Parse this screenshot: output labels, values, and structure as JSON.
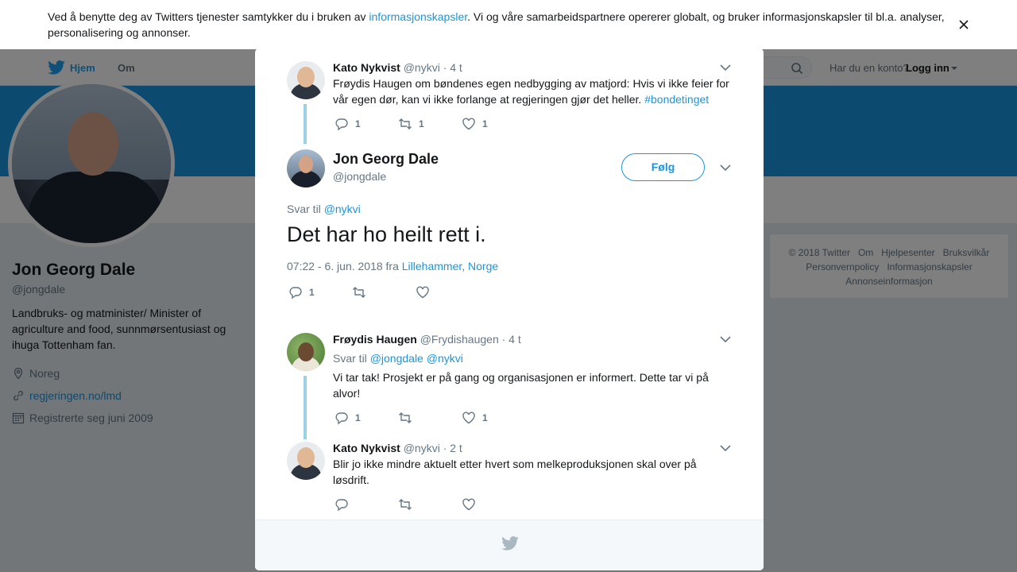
{
  "colors": {
    "accent": "#1b95e0",
    "thread_line": "#9cd0e3",
    "overlay": "rgba(0,0,0,0.5)"
  },
  "cookie_bar": {
    "text_before": "Ved å benytte deg av Twitters tjenester samtykker du i bruken av ",
    "link": "informasjonskapsler",
    "text_after": ". Vi og våre samarbeidspartnere opererer globalt, og bruker informasjonskapsler til bl.a. analyser, personalisering og annonser."
  },
  "topnav": {
    "home": "Hjem",
    "about": "Om",
    "have_account": "Har du en konto?",
    "login": "Logg inn"
  },
  "profile": {
    "name": "Jon Georg Dale",
    "handle": "@jongdale",
    "bio": "Landbruks- og matminister/ Minister of agriculture and food, sunnmørsentusiast og ihuga Tottenham fan.",
    "location": "Noreg",
    "website": "regjeringen.no/lmd",
    "joined": "Registrerte seg juni 2009"
  },
  "footer": {
    "items": [
      "© 2018 Twitter",
      "Om",
      "Hjelpesenter",
      "Bruksvilkår",
      "Personvernpolicy",
      "Informasjonskapsler",
      "Annonseinformasjon"
    ]
  },
  "modal": {
    "parent_tweet": {
      "name": "Kato Nykvist",
      "handle": "@nykvi",
      "time": "· 4 t",
      "text": "Frøydis Haugen om bøndenes egen nedbygging av matjord: Hvis vi ikke feier for vår egen dør, kan vi ikke forlange at regjeringen gjør det heller. ",
      "hashtag": "#bondetinget",
      "replies": "1",
      "retweets": "1",
      "likes": "1"
    },
    "main_tweet": {
      "name": "Jon Georg Dale",
      "handle": "@jongdale",
      "follow": "Følg",
      "reply_prefix": "Svar til ",
      "reply_mention": "@nykvi",
      "text": "Det har ho heilt rett i.",
      "meta_prefix": "07:22 - 6. jun. 2018 fra ",
      "location": "Lillehammer, Norge",
      "replies": "1"
    },
    "replies": [
      {
        "name": "Frøydis Haugen",
        "handle": "@Frydishaugen",
        "time": "· 4 t",
        "reply_prefix": "Svar til ",
        "mentions": "@jongdale @nykvi",
        "text": "Vi tar tak! Prosjekt er på gang og organisasjonen er informert. Dette tar vi på alvor!",
        "replies": "1",
        "likes": "1"
      },
      {
        "name": "Kato Nykvist",
        "handle": "@nykvi",
        "time": "· 2 t",
        "text": "Blir jo ikke mindre aktuelt etter hvert som melkeproduksjonen skal over på løsdrift."
      }
    ]
  }
}
